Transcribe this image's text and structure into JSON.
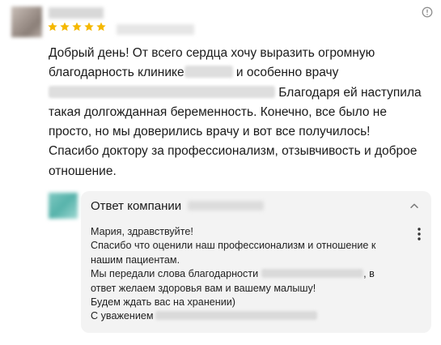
{
  "review": {
    "text_line1": "Добрый день! От всего сердца хочу выразить огромную",
    "text_line2a": "благодарность клинике",
    "text_line2b": " и особенно врачу",
    "text_line3b": " Благодаря ей наступила",
    "text_line4": "такая долгожданная беременность. Конечно, все было не",
    "text_line5": "просто, но мы доверились врачу и вот все получилось!",
    "text_line6": "Спасибо доктору за профессионализм, отзывчивость и доброе",
    "text_line7": "отношение.",
    "rating": 5
  },
  "reply": {
    "title": "Ответ компании",
    "line1": "Мария, здравствуйте!",
    "line2": "Спасибо что оценили наш профессионализм и отношение к",
    "line3": "нашим пациентам.",
    "line4a": "Мы передали слова благодарности",
    "line4b": ", в",
    "line5": "ответ желаем здоровья вам и вашему малышу!",
    "line6": "Будем ждать вас на хранении)",
    "line7a": "С уважением"
  },
  "icons": {
    "star": "star-icon",
    "info": "info-icon",
    "collapse": "chevron-up-icon",
    "menu": "kebab-menu-icon"
  },
  "colors": {
    "star": "#f5b800",
    "reply_bg": "#f3f3f3",
    "text": "#1a1a1a"
  }
}
